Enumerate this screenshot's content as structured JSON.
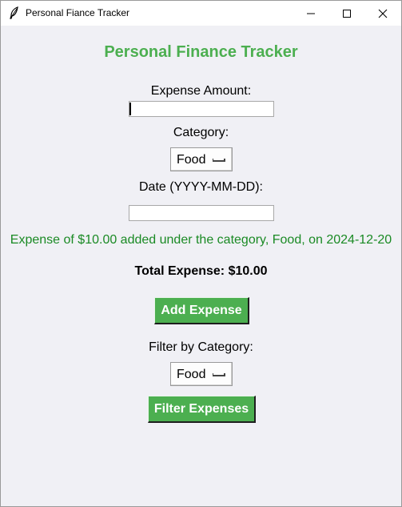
{
  "window": {
    "title": "Personal Fiance Tracker"
  },
  "app": {
    "heading": "Personal Finance Tracker",
    "accent_color": "#4caf50",
    "message_color": "#1a8a24"
  },
  "form": {
    "amount_label": "Expense Amount:",
    "amount_value": "",
    "category_label": "Category:",
    "category_selected": "Food",
    "date_label": "Date (YYYY-MM-DD):",
    "date_value": ""
  },
  "status": {
    "message": "Expense of $10.00 added under the category, Food, on 2024-12-20",
    "total": "Total Expense: $10.00"
  },
  "actions": {
    "add_label": "Add Expense",
    "filter_label": "Filter by Category:",
    "filter_selected": "Food",
    "filter_button_label": "Filter Expenses"
  },
  "icons": {
    "app_icon": "feather-icon",
    "minimize": "minimize-icon",
    "maximize": "maximize-icon",
    "close": "close-icon"
  }
}
